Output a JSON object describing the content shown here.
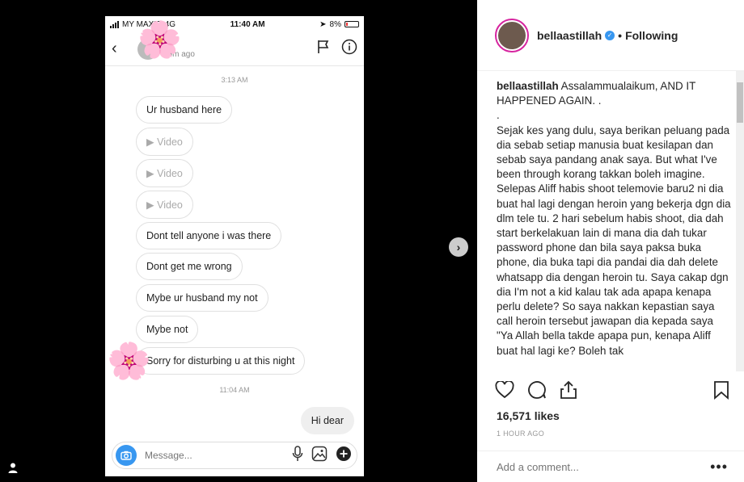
{
  "phone": {
    "carrier": "MY MAXIS",
    "network": "4G",
    "clock": "11:40 AM",
    "battery": "8%",
    "dm": {
      "name": "n",
      "active": "15m ago"
    },
    "thread": {
      "time1": "3:13 AM",
      "messages": [
        {
          "text": "Ur husband here"
        },
        {
          "text": "Video"
        },
        {
          "text": "Video"
        },
        {
          "text": "Video"
        },
        {
          "text": "Dont tell anyone i was there"
        },
        {
          "text": "Dont get me wrong"
        },
        {
          "text": "Mybe ur husband my not"
        },
        {
          "text": "Mybe not"
        },
        {
          "text": "Sorry for disturbing u at this night"
        }
      ],
      "time2": "11:04 AM",
      "reply": "Hi dear"
    },
    "composer_placeholder": "Message..."
  },
  "post": {
    "username": "bellaastillah",
    "follow_label": "Following",
    "caption_user": "bellaastillah",
    "caption_first": "Assalammualaikum, AND IT HAPPENED AGAIN. .",
    "caption_dot": ".",
    "caption_body": "Sejak kes yang dulu, saya berikan peluang pada dia sebab setiap manusia buat kesilapan dan sebab saya pandang anak saya. But what I've been through korang takkan boleh imagine. Selepas Aliff habis shoot telemovie baru2 ni dia buat hal lagi dengan heroin yang bekerja dgn dia dlm tele tu. 2 hari sebelum habis shoot, dia dah start berkelakuan lain di mana dia dah tukar password phone dan bila saya paksa buka phone, dia buka tapi dia pandai dia dah delete whatsapp dia dengan heroin tu. Saya cakap dgn dia I'm not a kid kalau tak ada apapa kenapa perlu delete? So saya nakkan kepastian saya call heroin tersebut jawapan dia kepada saya \"Ya Allah bella takde apapa pun, kenapa Aliff buat hal lagi ke? Boleh tak",
    "likes": "16,571 likes",
    "time_ago": "1 HOUR AGO",
    "comment_placeholder": "Add a comment...",
    "more_label": "•••"
  }
}
